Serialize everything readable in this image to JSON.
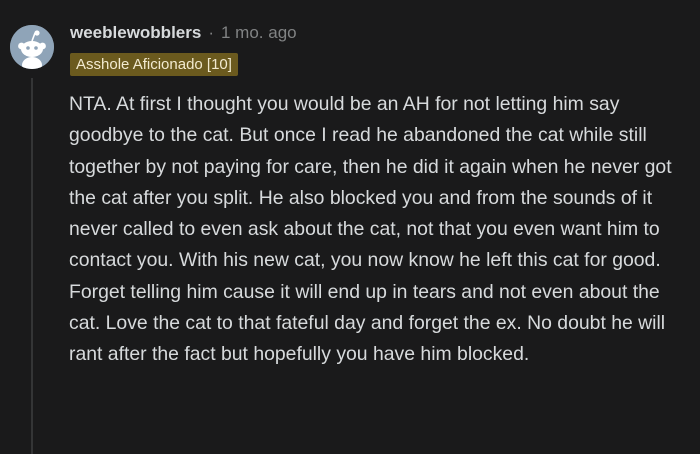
{
  "comment": {
    "author": "weeblewobblers",
    "separator": "·",
    "timestamp": "1 mo. ago",
    "flair": "Asshole Aficionado [10]",
    "body": "NTA. At first I thought you would be an AH for not letting him say goodbye to the cat. But once I read he abandoned the cat while still together by not paying for care, then he did it again when he never got the cat after you split. He also blocked you and from the sounds of it never called to even ask about the cat, not that you even want him to contact you. With his new cat, you now know he left this cat for good. Forget telling him cause it will end up in tears and not even about the cat. Love the cat to that fateful day and forget the ex. No doubt he will rant after the fact but hopefully you have him blocked."
  },
  "avatar": {
    "icon": "reddit-snoo-icon"
  },
  "colors": {
    "background": "#1a1a1b",
    "text": "#d7dadc",
    "muted": "#818384",
    "flair_background": "#6b5a1e",
    "avatar_background": "#8fa4b8"
  }
}
